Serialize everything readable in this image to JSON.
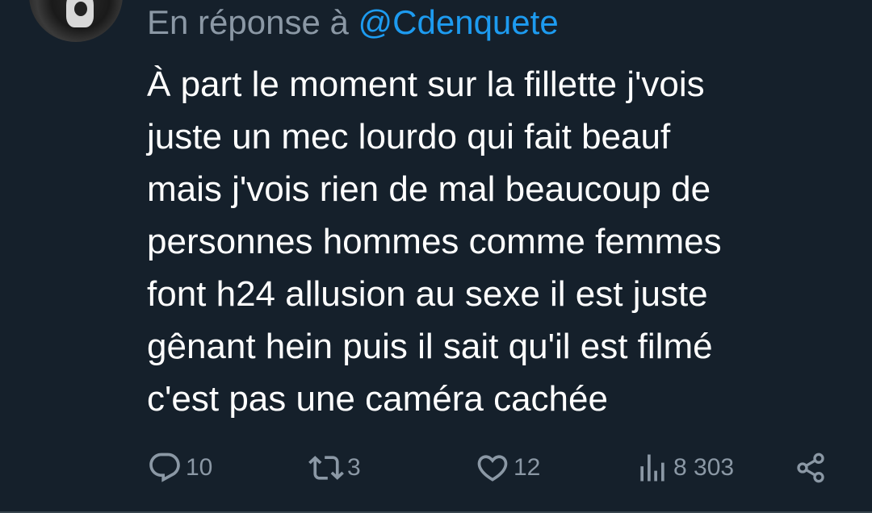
{
  "reply": {
    "prefix": "En réponse à",
    "handle": "@Cdenquete"
  },
  "tweet": {
    "lines": [
      "À part le moment sur la fillette j'vois",
      "juste un mec lourdo qui fait beauf",
      "mais j'vois rien de mal beaucoup de",
      "personnes hommes comme femmes",
      "font h24 allusion au sexe il est juste",
      "gênant hein puis il sait qu'il est filmé",
      "c'est pas une caméra cachée"
    ]
  },
  "actions": {
    "replies": "10",
    "retweets": "3",
    "likes": "12",
    "views": "8 303"
  },
  "icons": {
    "reply": "reply-icon",
    "retweet": "retweet-icon",
    "like": "heart-icon",
    "views": "analytics-icon",
    "share": "share-icon"
  },
  "colors": {
    "background": "#15202b",
    "text": "#ffffff",
    "secondary": "#8b98a5",
    "link": "#1d9bf0",
    "divider": "#38444d"
  }
}
